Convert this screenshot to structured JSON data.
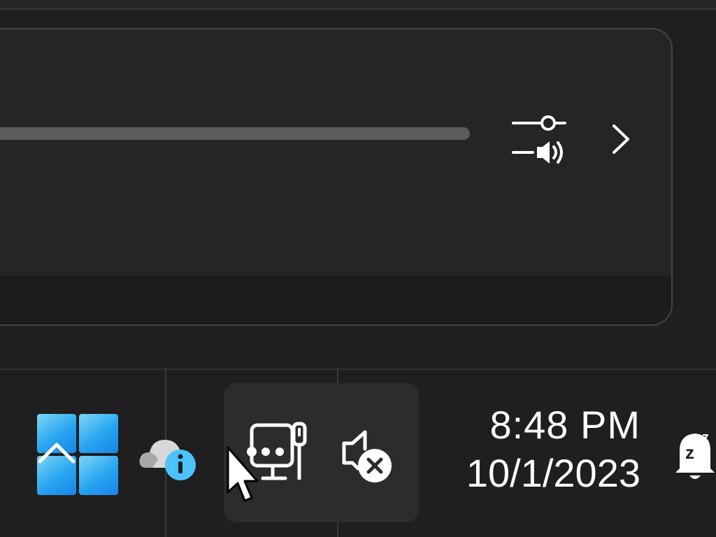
{
  "flyout": {
    "volume": {
      "level": 1.0
    },
    "mixer_button": {
      "icon": "sound-mixer-icon"
    },
    "chevron": {
      "icon": "chevron-right-icon"
    }
  },
  "taskbar": {
    "start_button": {
      "icon": "windows-start-icon",
      "overlay_icon": "chevron-up-icon"
    },
    "onedrive": {
      "icon": "onedrive-cloud-info-icon",
      "accent_color": "#4cc2ff"
    },
    "tray": {
      "network_icon": "ethernet-network-icon",
      "sound_icon": "speaker-muted-icon"
    },
    "clock": {
      "time": "8:48 PM",
      "date": "10/1/2023"
    },
    "notifications": {
      "icon": "notification-bell-snooze-icon"
    }
  },
  "colors": {
    "background": "#1f1f1f",
    "flyout_background": "#252525",
    "slider_track": "#5c5c5c",
    "start_blue": "#27a5f0",
    "text": "#ffffff"
  }
}
